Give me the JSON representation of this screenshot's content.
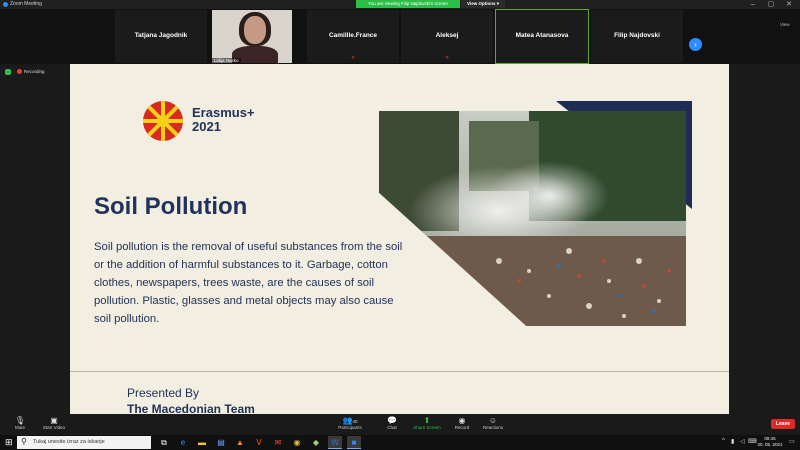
{
  "window": {
    "app_title": "Zoom Meeting",
    "share_banner": "You are viewing Filip Najdovski's screen",
    "view_options": "View Options ▾",
    "controls": [
      "–",
      "▢",
      "✕"
    ]
  },
  "participants": {
    "tiles": [
      {
        "name": "Tatjana Jagodnik",
        "muted": false
      },
      {
        "name": "Camillle.France",
        "muted": true
      },
      {
        "name": "Aleksej",
        "muted": true
      },
      {
        "name": "Matea Atanasova",
        "muted": false,
        "active": true
      },
      {
        "name": "Filip Najdovski",
        "muted": false
      }
    ],
    "video_name": "Lidija Nasko",
    "next_icon": "chevron-right-icon",
    "view_label": "View"
  },
  "recording": {
    "label": "Recording"
  },
  "slide": {
    "brand_line1": "Erasmus+",
    "brand_line2": "2021",
    "title": "Soil Pollution",
    "body": "Soil pollution is the removal of useful substances from the soil or the addition of harmful substances to it. Garbage, cotton clothes, newspapers, trees waste, are the causes of soil pollution. Plastic, glasses and metal objects may also cause soil pollution.",
    "presented_by": "Presented By",
    "team": "The Macedonian Team",
    "colors": {
      "background": "#f2eee1",
      "navy": "#22335a",
      "flag_red": "#d62b1e",
      "flag_yellow": "#f7d117"
    }
  },
  "toolbar": {
    "items": [
      {
        "label": "Mute",
        "icon": "microphone-icon"
      },
      {
        "label": "Start Video",
        "icon": "video-camera-icon"
      },
      {
        "label": "Participants",
        "icon": "people-icon",
        "count": "40"
      },
      {
        "label": "Chat",
        "icon": "chat-icon"
      },
      {
        "label": "Share Screen",
        "icon": "share-screen-icon"
      },
      {
        "label": "Record",
        "icon": "record-icon"
      },
      {
        "label": "Reactions",
        "icon": "smiley-icon"
      }
    ],
    "leave_label": "Leave"
  },
  "taskbar": {
    "search_placeholder": "Tukaj unesite izraz za iskanje",
    "time": "08:45",
    "date": "20. 05. 2021"
  }
}
